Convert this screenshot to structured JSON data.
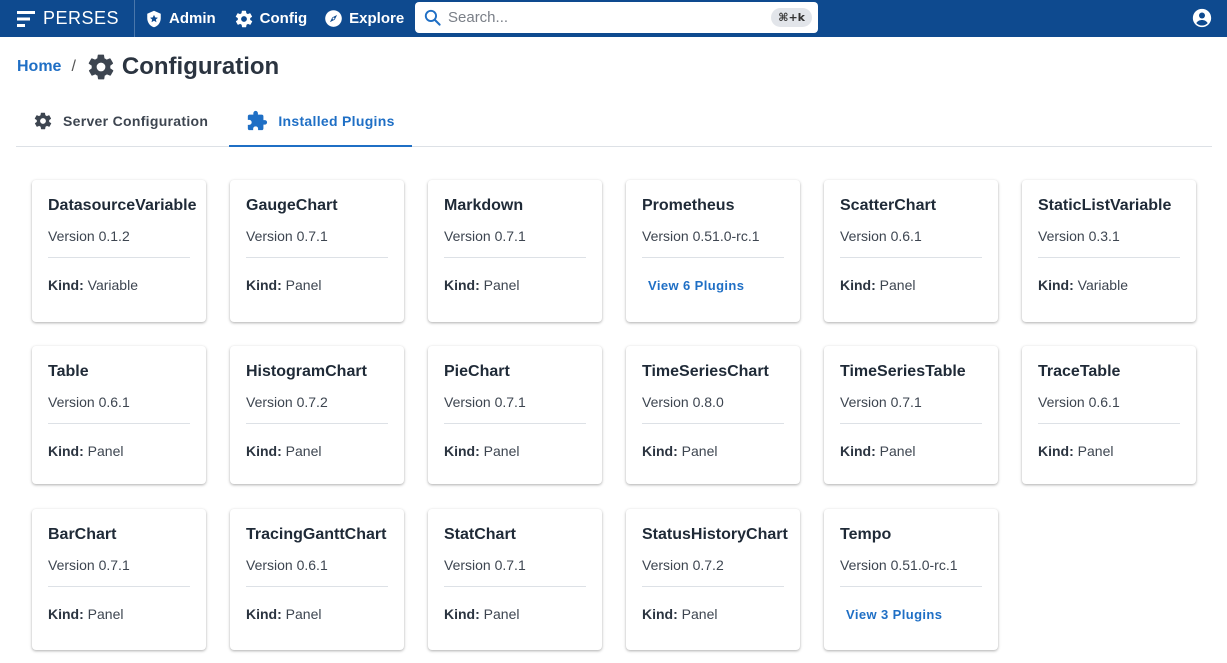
{
  "app": {
    "logo_text": "PERSES"
  },
  "nav": {
    "admin": "Admin",
    "config": "Config",
    "explore": "Explore"
  },
  "search": {
    "placeholder": "Search...",
    "shortcut": "⌘+k"
  },
  "breadcrumb": {
    "home": "Home",
    "separator": "/",
    "title": "Configuration"
  },
  "tabs": [
    {
      "label": "Server Configuration",
      "icon": "gear-icon",
      "selected": false
    },
    {
      "label": "Installed Plugins",
      "icon": "puzzle-icon",
      "selected": true
    }
  ],
  "kind_label": "Kind:",
  "plugins": [
    {
      "name": "DatasourceVariable",
      "version": "Version 0.1.2",
      "kind": "Variable"
    },
    {
      "name": "GaugeChart",
      "version": "Version 0.7.1",
      "kind": "Panel"
    },
    {
      "name": "Markdown",
      "version": "Version 0.7.1",
      "kind": "Panel"
    },
    {
      "name": "Prometheus",
      "version": "Version 0.51.0-rc.1",
      "link": "View 6 Plugins"
    },
    {
      "name": "ScatterChart",
      "version": "Version 0.6.1",
      "kind": "Panel"
    },
    {
      "name": "StaticListVariable",
      "version": "Version 0.3.1",
      "kind": "Variable"
    },
    {
      "name": "Table",
      "version": "Version 0.6.1",
      "kind": "Panel"
    },
    {
      "name": "HistogramChart",
      "version": "Version 0.7.2",
      "kind": "Panel"
    },
    {
      "name": "PieChart",
      "version": "Version 0.7.1",
      "kind": "Panel"
    },
    {
      "name": "TimeSeriesChart",
      "version": "Version 0.8.0",
      "kind": "Panel"
    },
    {
      "name": "TimeSeriesTable",
      "version": "Version 0.7.1",
      "kind": "Panel"
    },
    {
      "name": "TraceTable",
      "version": "Version 0.6.1",
      "kind": "Panel"
    },
    {
      "name": "BarChart",
      "version": "Version 0.7.1",
      "kind": "Panel"
    },
    {
      "name": "TracingGanttChart",
      "version": "Version 0.6.1",
      "kind": "Panel"
    },
    {
      "name": "StatChart",
      "version": "Version 0.7.1",
      "kind": "Panel"
    },
    {
      "name": "StatusHistoryChart",
      "version": "Version 0.7.2",
      "kind": "Panel"
    },
    {
      "name": "Tempo",
      "version": "Version 0.51.0-rc.1",
      "link": "View 3 Plugins"
    }
  ],
  "colors": {
    "topbar": "#0e4a8f",
    "accent": "#1f6fc5"
  }
}
